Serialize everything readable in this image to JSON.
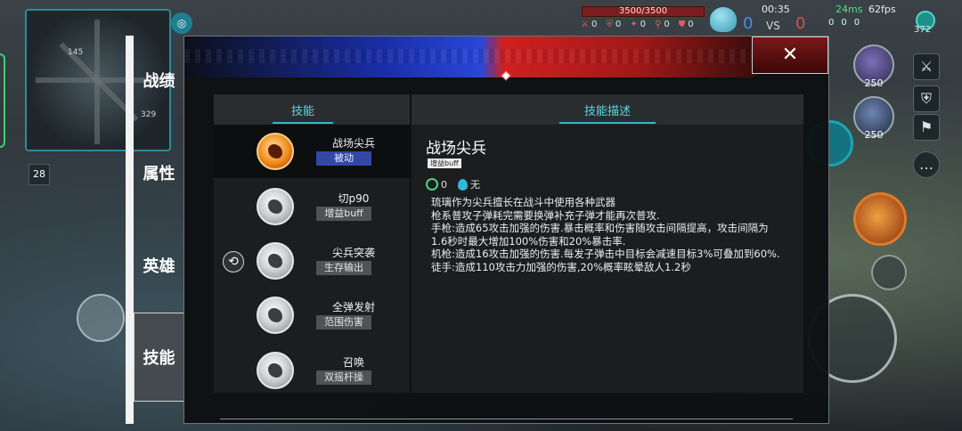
{
  "hud": {
    "base_hp": "3500/3500",
    "team_stats": [
      "0",
      "0",
      "0",
      "0",
      "0"
    ],
    "score_left": "0",
    "vs_label": "VS",
    "score_right": "0",
    "time": "00:35",
    "ping": "24ms",
    "fps": "62fps",
    "gold": "372",
    "kda": [
      "0",
      "0",
      "0"
    ],
    "minimap_labels": [
      "145",
      "329"
    ],
    "badge": "28",
    "hero_levels": [
      "250",
      "250"
    ]
  },
  "side_tabs": [
    {
      "label": "战绩"
    },
    {
      "label": "属性"
    },
    {
      "label": "英雄"
    },
    {
      "label": "技能",
      "active": true
    }
  ],
  "close_label": "✕",
  "skills_panel": {
    "header": "技能",
    "skills": [
      {
        "name": "战场尖兵",
        "tag": "被动",
        "selected": true
      },
      {
        "name": "切p90",
        "tag": "增益buff"
      },
      {
        "name": "尖兵突袭",
        "tag": "生存输出"
      },
      {
        "name": "全弹发射",
        "tag": "范围伤害"
      },
      {
        "name": "召唤",
        "tag": "双摇杆操"
      }
    ],
    "swap_icon": "⟲"
  },
  "description_panel": {
    "header": "技能描述",
    "title": "战场尖兵",
    "tag": "增益buff",
    "cooldown": "0",
    "mana": "无",
    "body": "琉璃作为尖兵擅长在战斗中使用各种武器\n枪系普攻子弹耗完需要换弹补充子弹才能再次普攻.\n手枪:造成65攻击加强的伤害.暴击概率和伤害随攻击间隔提高，攻击间隔为1.6秒时最大增加100%伤害和20%暴击率.\n机枪:造成16攻击加强的伤害.每发子弹击中目标会减速目标3%可叠加到60%.\n徒手:造成110攻击力加强的伤害,20%概率眩晕敌人1.2秒"
  },
  "colors": {
    "accent": "#2fb8c8",
    "tag_blue": "#3248a4",
    "team_blue": "#2846d8",
    "team_red": "#d02020"
  }
}
